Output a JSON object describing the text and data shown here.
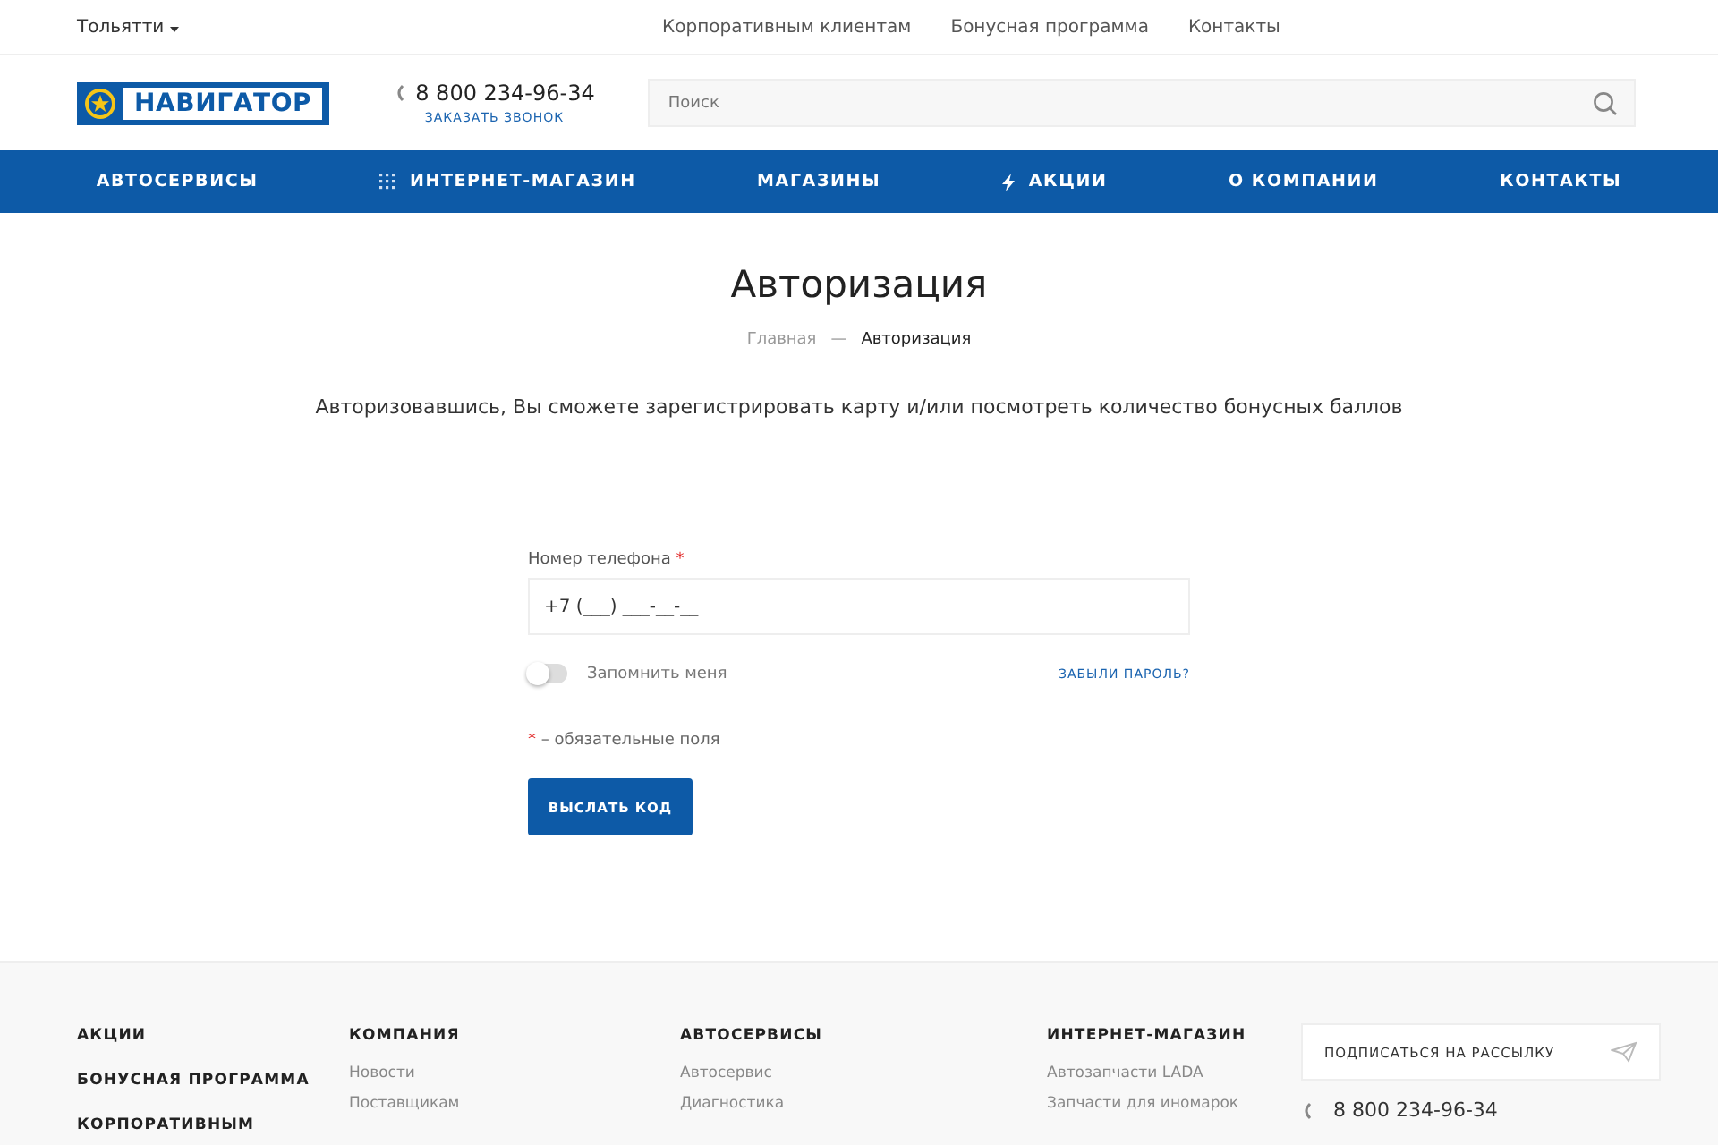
{
  "topbar": {
    "city": "Тольятти",
    "links": [
      "Корпоративным клиентам",
      "Бонусная программа",
      "Контакты"
    ]
  },
  "header": {
    "logo": "НАВИГАТОР",
    "phone": "8 800 234-96-34",
    "callback": "ЗАКАЗАТЬ ЗВОНОК",
    "search": {
      "placeholder": "Поиск"
    }
  },
  "nav": [
    {
      "label": "АВТОСЕРВИСЫ",
      "kind": "plain"
    },
    {
      "label": "ИНТЕРНЕТ-МАГАЗИН",
      "kind": "catalog"
    },
    {
      "label": "МАГАЗИНЫ",
      "kind": "plain"
    },
    {
      "label": "АКЦИИ",
      "kind": "promo"
    },
    {
      "label": "О КОМПАНИИ",
      "kind": "plain"
    },
    {
      "label": "КОНТАКТЫ",
      "kind": "plain"
    }
  ],
  "page": {
    "title": "Авторизация",
    "breadcrumbs": [
      "Главная",
      "—",
      "Авторизация"
    ],
    "intro": "Авторизовавшись, Вы сможете зарегистрировать карту и/или посмотреть количество бонусных баллов"
  },
  "form": {
    "phone_label": "Номер телефона",
    "required_mark": "*",
    "phone_value": "+7 (___) ___-__-__",
    "remember": {
      "label": "Запомнить меня",
      "on": false
    },
    "forgot": "ЗАБЫЛИ ПАРОЛЬ?",
    "required_note": "– обязательные поля",
    "submit": "ВЫСЛАТЬ КОД"
  },
  "footer": {
    "main_links": [
      "АКЦИИ",
      "БОНУСНАЯ ПРОГРАММА",
      "КОРПОРАТИВНЫМ"
    ],
    "columns": [
      {
        "title": "КОМПАНИЯ",
        "links": [
          "Новости",
          "Поставщикам"
        ]
      },
      {
        "title": "АВТОСЕРВИСЫ",
        "links": [
          "Автосервис",
          "Диагностика"
        ]
      },
      {
        "title": "ИНТЕРНЕТ-МАГАЗИН",
        "links": [
          "Автозапчасти LADA",
          "Запчасти для иномарок"
        ]
      }
    ],
    "subscribe": "ПОДПИСАТЬСЯ НА РАССЫЛКУ",
    "phone": "8 800 234-96-34"
  }
}
